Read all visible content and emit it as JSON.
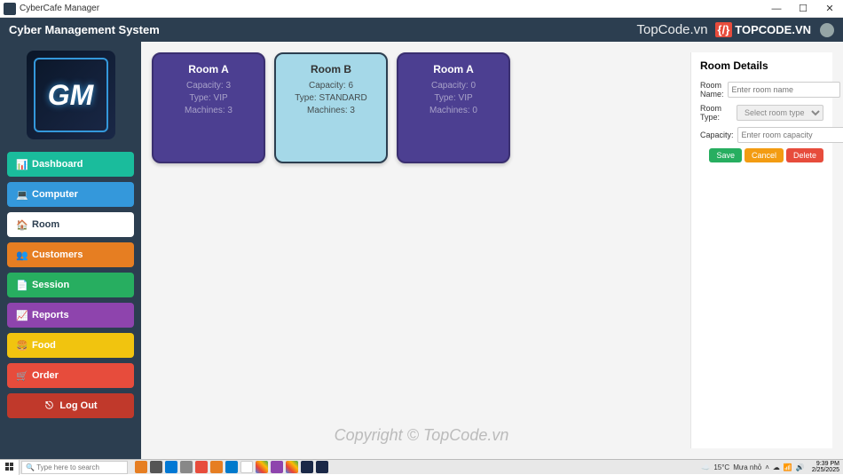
{
  "window": {
    "title": "CyberCafe Manager"
  },
  "header": {
    "title": "Cyber Management System",
    "brand": "TopCode.vn",
    "wm_code": "{/}",
    "wm_text": "TOPCODE.VN"
  },
  "sidebar": {
    "logo_text": "GM",
    "items": [
      {
        "icon": "📊",
        "label": "Dashboard",
        "cls": "nb-dashboard"
      },
      {
        "icon": "💻",
        "label": "Computer",
        "cls": "nb-computer"
      },
      {
        "icon": "🏠",
        "label": "Room",
        "cls": "nb-room"
      },
      {
        "icon": "👥",
        "label": "Customers",
        "cls": "nb-customers"
      },
      {
        "icon": "📄",
        "label": "Session",
        "cls": "nb-session"
      },
      {
        "icon": "📈",
        "label": "Reports",
        "cls": "nb-reports"
      },
      {
        "icon": "🍔",
        "label": "Food",
        "cls": "nb-food"
      },
      {
        "icon": "🛒",
        "label": "Order",
        "cls": "nb-order"
      },
      {
        "icon": "⎋",
        "label": "Log Out",
        "cls": "nb-logout"
      }
    ]
  },
  "rooms": [
    {
      "title": "Room A",
      "capacity": "Capacity: 3",
      "type": "Type: VIP",
      "machines": "Machines: 3",
      "selected": false
    },
    {
      "title": "Room B",
      "capacity": "Capacity: 6",
      "type": "Type: STANDARD",
      "machines": "Machines: 3",
      "selected": true
    },
    {
      "title": "Room A",
      "capacity": "Capacity: 0",
      "type": "Type: VIP",
      "machines": "Machines: 0",
      "selected": false
    }
  ],
  "details": {
    "heading": "Room Details",
    "name_label": "Room Name:",
    "name_ph": "Enter room name",
    "type_label": "Room Type:",
    "type_ph": "Select room type",
    "cap_label": "Capacity:",
    "cap_ph": "Enter room capacity",
    "save": "Save",
    "cancel": "Cancel",
    "delete": "Delete"
  },
  "watermark": "Copyright © TopCode.vn",
  "taskbar": {
    "search_ph": "Type here to search",
    "weather_temp": "15°C",
    "weather_text": "Mưa nhỏ",
    "time": "9:39 PM",
    "date": "2/25/2025"
  }
}
